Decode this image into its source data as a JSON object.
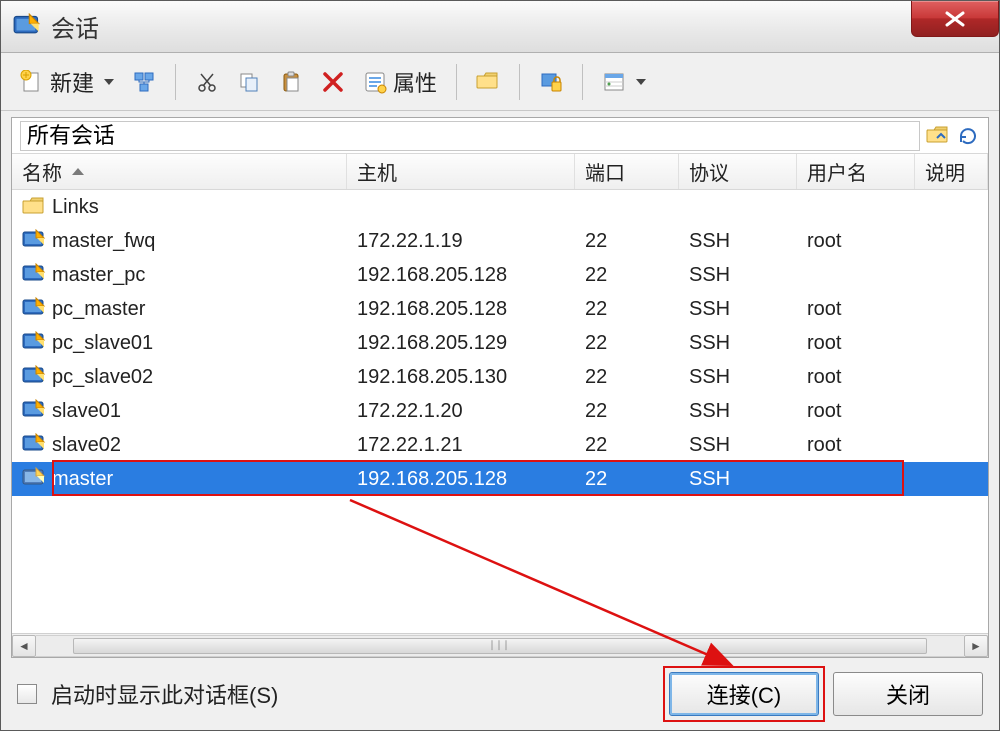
{
  "window": {
    "title": "会话"
  },
  "toolbar": {
    "new_label": "新建",
    "props_label": "属性"
  },
  "path": {
    "text": "所有会话"
  },
  "columns": {
    "name": "名称",
    "host": "主机",
    "port": "端口",
    "proto": "协议",
    "user": "用户名",
    "desc": "说明"
  },
  "folder": {
    "name": "Links"
  },
  "sessions": [
    {
      "name": "master_fwq",
      "host": "172.22.1.19",
      "port": "22",
      "proto": "SSH",
      "user": "root",
      "desc": ""
    },
    {
      "name": "master_pc",
      "host": "192.168.205.128",
      "port": "22",
      "proto": "SSH",
      "user": "",
      "desc": ""
    },
    {
      "name": "pc_master",
      "host": "192.168.205.128",
      "port": "22",
      "proto": "SSH",
      "user": "root",
      "desc": ""
    },
    {
      "name": "pc_slave01",
      "host": "192.168.205.129",
      "port": "22",
      "proto": "SSH",
      "user": "root",
      "desc": ""
    },
    {
      "name": "pc_slave02",
      "host": "192.168.205.130",
      "port": "22",
      "proto": "SSH",
      "user": "root",
      "desc": ""
    },
    {
      "name": "slave01",
      "host": "172.22.1.20",
      "port": "22",
      "proto": "SSH",
      "user": "root",
      "desc": ""
    },
    {
      "name": "slave02",
      "host": "172.22.1.21",
      "port": "22",
      "proto": "SSH",
      "user": "root",
      "desc": ""
    },
    {
      "name": "master",
      "host": "192.168.205.128",
      "port": "22",
      "proto": "SSH",
      "user": "",
      "desc": "",
      "selected": true
    }
  ],
  "footer": {
    "startup_label": "启动时显示此对话框(S)",
    "connect_label": "连接(C)",
    "close_label": "关闭"
  }
}
